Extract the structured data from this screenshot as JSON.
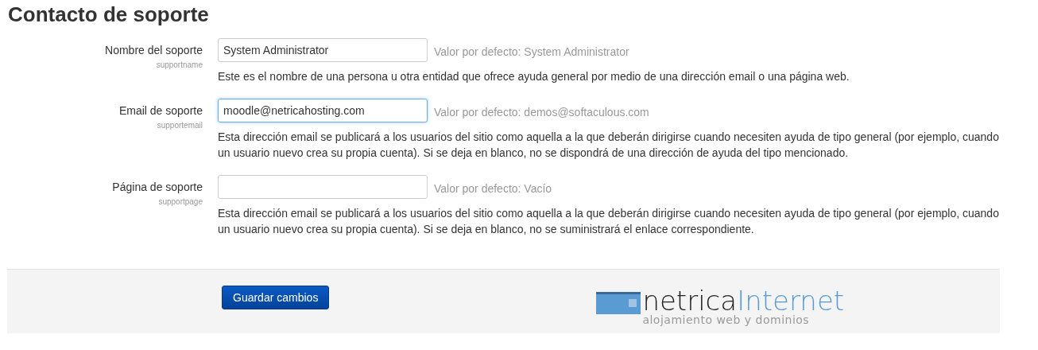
{
  "title": "Contacto de soporte",
  "settings": [
    {
      "label": "Nombre del soporte",
      "key": "supportname",
      "value": "System Administrator",
      "focused": false,
      "default": "Valor por defecto: System Administrator",
      "description": "Este es el nombre de una persona u otra entidad que ofrece ayuda general por medio de una dirección email o una página web."
    },
    {
      "label": "Email de soporte",
      "key": "supportemail",
      "value": "moodle@netricahosting.com",
      "focused": true,
      "default": "Valor por defecto: demos@softaculous.com",
      "description": "Esta dirección email se publicará a los usuarios del sitio como aquella a la que deberán dirigirse cuando necesiten ayuda de tipo general (por ejemplo, cuando un usuario nuevo crea su propia cuenta). Si se deja en blanco, no se dispondrá de una dirección de ayuda del tipo mencionado."
    },
    {
      "label": "Página de soporte",
      "key": "supportpage",
      "focused": false,
      "default": "Valor por defecto: Vacío",
      "description": "Esta dirección email se publicará a los usuarios del sitio como aquella a la que deberán dirigirse cuando necesiten ayuda de tipo general (por ejemplo, cuando un usuario nuevo crea su propia cuenta). Si se deja en blanco, no se suministrará el enlace correspondiente."
    }
  ],
  "save_button": "Guardar cambios",
  "logo": {
    "name_dark": "netrica",
    "name_light": "Internet",
    "tagline": "alojamiento web y dominios"
  }
}
